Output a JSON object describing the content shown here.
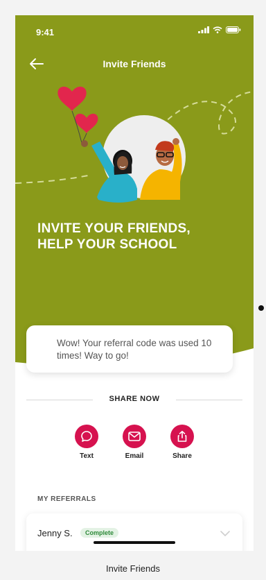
{
  "status_bar": {
    "time": "9:41"
  },
  "nav": {
    "title": "Invite Friends"
  },
  "hero": {
    "headline": "INVITE YOUR FRIENDS,\nHELP YOUR SCHOOL",
    "background_color": "#8a9a1a"
  },
  "notice": {
    "text": "Wow! Your referral code was used 10 times! Way to go!"
  },
  "share": {
    "heading": "SHARE NOW",
    "buttons": [
      {
        "label": "Text",
        "icon": "chat-bubble-icon"
      },
      {
        "label": "Email",
        "icon": "envelope-icon"
      },
      {
        "label": "Share",
        "icon": "share-upload-icon"
      }
    ],
    "accent_color": "#d6124f"
  },
  "referrals": {
    "heading": "MY REFERRALS",
    "items": [
      {
        "name": "Jenny S.",
        "status": "Complete"
      }
    ]
  },
  "caption": "Invite Friends"
}
